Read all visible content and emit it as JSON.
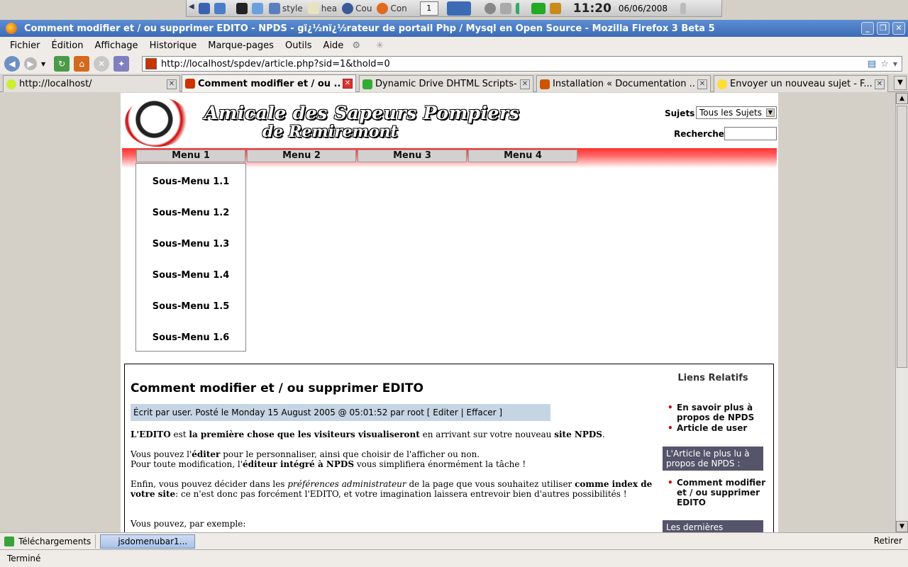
{
  "kde_panel": {
    "tasks": [
      "style",
      "hea",
      "Cou",
      "Con"
    ],
    "desktop_num": "1",
    "clock": "11:20",
    "date": "06/06/2008"
  },
  "window": {
    "title": "Comment modifier et / ou supprimer EDITO - NPDS - gï¿½nï¿½rateur de portail Php / Mysql en Open Source - Mozilla Firefox 3 Beta 5"
  },
  "menubar": [
    "Fichier",
    "Édition",
    "Affichage",
    "Historique",
    "Marque-pages",
    "Outils",
    "Aide"
  ],
  "address": {
    "url": "http://localhost/spdev/article.php?sid=1&thold=0"
  },
  "tabs": [
    {
      "label": "http://localhost/",
      "color": "#ccee33"
    },
    {
      "label": "Comment modifier et / ou ...",
      "color": "#cc3300"
    },
    {
      "label": "Dynamic Drive DHTML Scripts-...",
      "color": "#33aa33"
    },
    {
      "label": "Installation « Documentation ...",
      "color": "#cc5500"
    },
    {
      "label": "Envoyer un nouveau sujet - F...",
      "color": "#ffdd33"
    }
  ],
  "site": {
    "title": "Amicale des Sapeurs Pompiers",
    "subtitle": "de Remiremont",
    "topics_label": "Sujets",
    "topics_value": "Tous les Sujets",
    "search_label": "Recherche"
  },
  "menus": [
    "Menu 1",
    "Menu 2",
    "Menu 3",
    "Menu 4"
  ],
  "submenu": [
    "Sous-Menu 1.1",
    "Sous-Menu 1.2",
    "Sous-Menu 1.3",
    "Sous-Menu 1.4",
    "Sous-Menu 1.5",
    "Sous-Menu 1.6"
  ],
  "article": {
    "title": "Comment modifier et / ou supprimer EDITO",
    "meta": "Écrit par user. Posté le Monday 15 August 2005 @ 05:01:52 par root  [ Editer | Effacer ]",
    "p1_a": "L'EDITO",
    "p1_b": " est ",
    "p1_c": "la première chose que les visiteurs visualiseront",
    "p1_d": " en arrivant sur votre nouveau ",
    "p1_e": "site NPDS",
    "p1_f": ".",
    "p2_a": "Vous pouvez l'",
    "p2_b": "éditer",
    "p2_c": " pour le personnaliser, ainsi que choisir de l'afficher ou non.",
    "p2_d": "Pour toute modification, l'",
    "p2_e": "éditeur intégré à NPDS",
    "p2_f": " vous simplifiera énormément la tâche !",
    "p3_a": "Enfin, vous pouvez décider dans les ",
    "p3_b": "préférences administrateur",
    "p3_c": " de la page que vous souhaitez utiliser ",
    "p3_d": "comme index de votre site",
    "p3_e": ": ce n'est donc pas forcément l'EDITO, et votre imagination laissera entrevoir bien d'autres possibilités !",
    "p4": "Vous pouvez, par exemple:"
  },
  "sidebar": {
    "title": "Liens Relatifs",
    "links": [
      "En savoir plus à propos de NPDS",
      "Article de user"
    ],
    "box1": "L'Article le plus lu à propos de  NPDS :",
    "most_read": "Comment modifier et / ou supprimer EDITO",
    "box2": "Les dernières"
  },
  "downloads": {
    "label": "Téléchargements",
    "item": "jsdomenubar1...",
    "retry": "Retirer"
  },
  "status": "Terminé"
}
